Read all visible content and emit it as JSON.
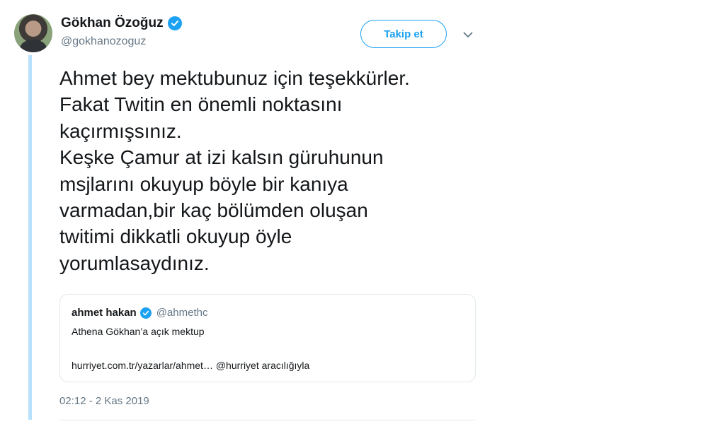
{
  "author": {
    "name": "Gökhan Özoğuz",
    "handle": "@gokhanozoguz",
    "verified": true,
    "avatar_icon": "profile-photo"
  },
  "follow_button": {
    "label": "Takip et"
  },
  "menu_icon": "chevron-down-icon",
  "tweet": {
    "text": "Ahmet bey mektubunuz için teşekkürler.\nFakat Twitin en önemli  noktasını\nkaçırmışsınız.\nKeşke Çamur at izi kalsın güruhunun\nmsjlarını okuyup böyle bir kanıya\nvarmadan,bir kaç bölümden oluşan\ntwitimi dikkatli okuyup öyle\nyorumlasaydınız."
  },
  "quote": {
    "name": "ahmet hakan",
    "handle": "@ahmethc",
    "verified": true,
    "title": "Athena Gökhan’a açık mektup",
    "link": "hurriyet.com.tr/yazarlar/ahmet… @hurriyet aracılığıyla"
  },
  "timestamp": "02:12 - 2 Kas 2019",
  "colors": {
    "accent": "#1da1f2",
    "thread_line": "#b9e0fb",
    "secondary_text": "#657786",
    "border": "#e1e8ed"
  }
}
